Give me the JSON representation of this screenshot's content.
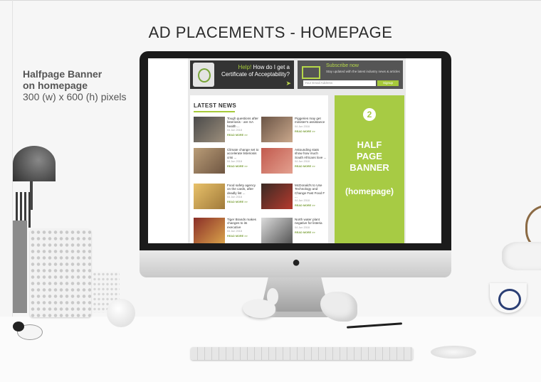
{
  "header": {
    "title": "AD PLACEMENTS - HOMEPAGE"
  },
  "side_label": {
    "line1": "Halfpage Banner",
    "line2": "on homepage",
    "line3": "300 (w) x 600 (h) pixels"
  },
  "website": {
    "ad_help": {
      "help_word": "Help!",
      "text": "How do I get a Certificate of Acceptability?"
    },
    "subscribe": {
      "heading": "Subscribe now",
      "body": "Stay updated with the latest industry news & articles",
      "input_placeholder": "Your Email Address",
      "button": "Signup"
    },
    "latest_news": {
      "title": "LATEST NEWS",
      "items": [
        {
          "headline": "Tough questions after listeriosis - are SA health ...",
          "date": "04 Jun 2018",
          "more": "READ MORE >>"
        },
        {
          "headline": "Piggeries may get minister's assistance",
          "date": "04 Jun 2018",
          "more": "READ MORE >>"
        },
        {
          "headline": "Climate change set to accelerate listeriosis crisi ...",
          "date": "04 Jun 2018",
          "more": "READ MORE >>"
        },
        {
          "headline": "Astounding stats show how much South Africans love ...",
          "date": "04 Jun 2018",
          "more": "READ MORE >>"
        },
        {
          "headline": "Food safety agency on the cards, after deadly list ...",
          "date": "04 Jun 2018",
          "more": "READ MORE >>"
        },
        {
          "headline": "McDonald's to Use Technology and Change Fast Food F ...",
          "date": "04 Jun 2018",
          "more": "READ MORE >>"
        },
        {
          "headline": "Tiger Brands makes changes to its executive",
          "date": "04 Jun 2018",
          "more": "READ MORE >>"
        },
        {
          "headline": "North water plant negative for listeria",
          "date": "04 Jun 2018",
          "more": "READ MORE >>"
        }
      ]
    },
    "halfpage_banner": {
      "number": "2",
      "line1": "HALF",
      "line2": "PAGE",
      "line3": "BANNER",
      "sub": "(homepage)"
    }
  },
  "colors": {
    "accent_green": "#a7cb44",
    "dark_bar": "#333333",
    "monitor_bezel": "#1b1b1b"
  }
}
